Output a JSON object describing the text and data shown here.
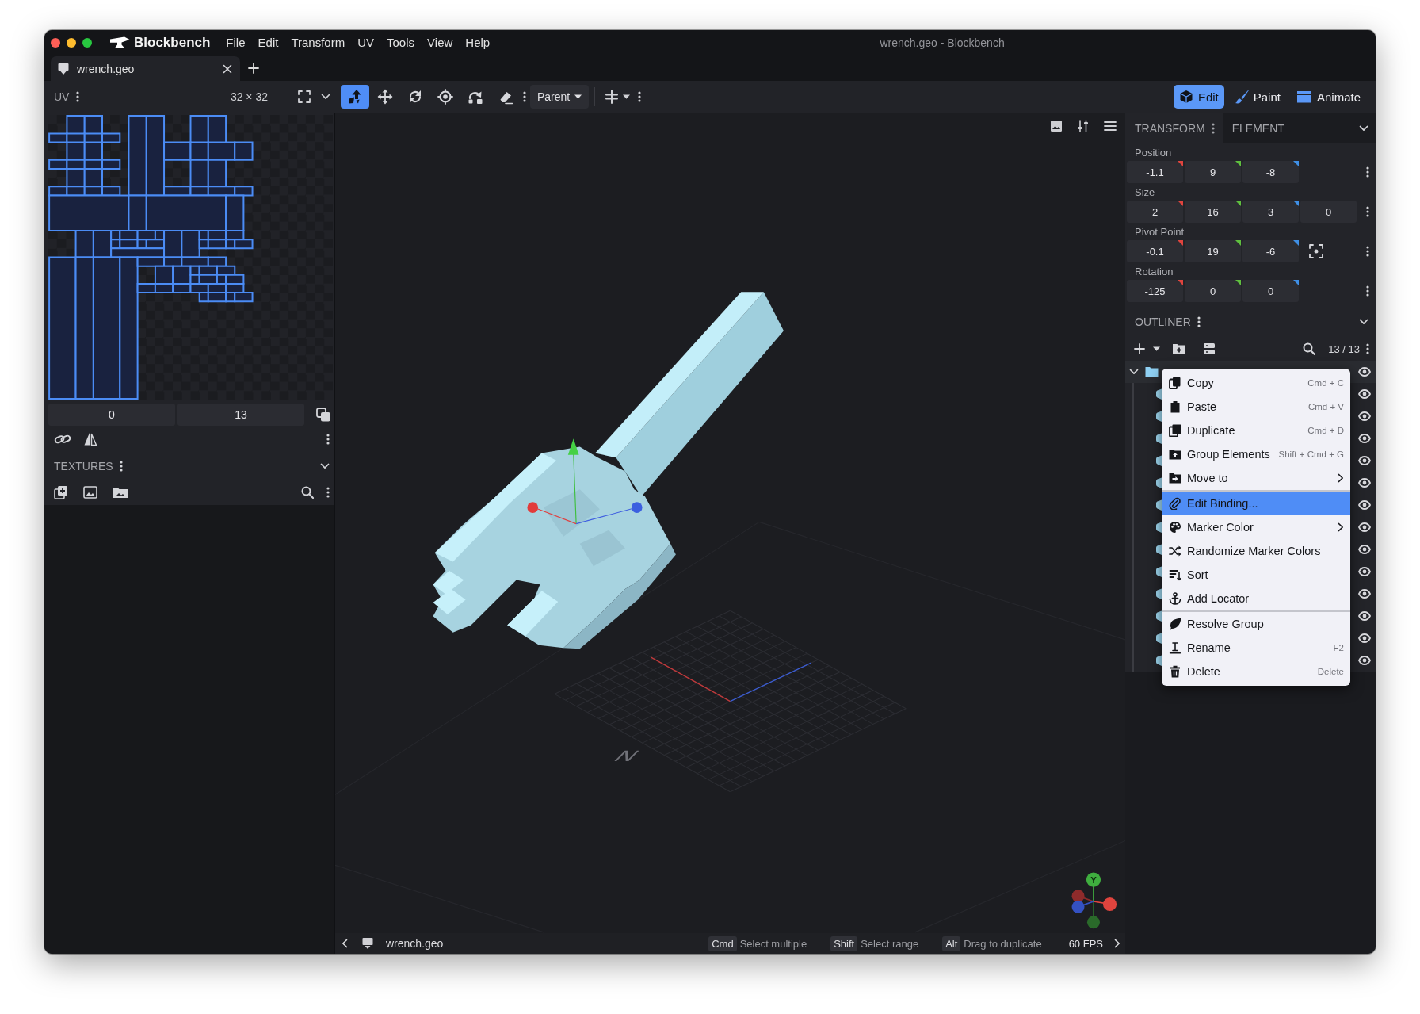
{
  "window": {
    "app_name": "Blockbench",
    "title": "wrench.geo - Blockbench"
  },
  "menu_bar": [
    "File",
    "Edit",
    "Transform",
    "UV",
    "Tools",
    "View",
    "Help"
  ],
  "tabs": [
    {
      "label": "wrench.geo",
      "selected": true
    }
  ],
  "toolbar": {
    "uv_title": "UV",
    "texture_size": "32 × 32",
    "tools": [
      {
        "selected": true
      },
      {
        "selected": false
      },
      {
        "selected": false
      },
      {
        "selected": false
      },
      {
        "selected": false
      },
      {
        "selected": false
      }
    ],
    "transform_space": "Parent"
  },
  "modes": [
    {
      "label": "Edit",
      "selected": true
    },
    {
      "label": "Paint",
      "selected": false
    },
    {
      "label": "Animate",
      "selected": false
    }
  ],
  "uv_panel": {
    "fields": [
      "0",
      "13"
    ]
  },
  "textures_panel": {
    "title": "TEXTURES"
  },
  "viewport": {
    "compass_label": "N",
    "axis_label": "Y"
  },
  "transform_panel": {
    "tabs": [
      {
        "label": "TRANSFORM",
        "selected": true
      },
      {
        "label": "ELEMENT",
        "selected": false
      }
    ],
    "rows": [
      {
        "kind": "vector",
        "label": "Position",
        "values": [
          "-1.1",
          "9",
          "-8"
        ]
      },
      {
        "kind": "vector",
        "label": "Size",
        "values": [
          "2",
          "16",
          "3",
          "0"
        ]
      },
      {
        "kind": "pivot",
        "label": "Pivot Point",
        "values": [
          "-0.1",
          "19",
          "-6"
        ]
      },
      {
        "kind": "vector",
        "label": "Rotation",
        "values": [
          "-125",
          "0",
          "0"
        ]
      }
    ]
  },
  "outliner": {
    "title": "OUTLINER",
    "count": "13 / 13",
    "tree": [
      {
        "kind": "group",
        "expanded": true,
        "visible": true,
        "children": [
          {
            "kind": "cube",
            "visible": true
          },
          {
            "kind": "cube",
            "visible": true
          },
          {
            "kind": "cube",
            "visible": true
          },
          {
            "kind": "cube",
            "visible": true
          },
          {
            "kind": "cube",
            "visible": true
          },
          {
            "kind": "cube",
            "visible": true
          },
          {
            "kind": "cube",
            "visible": true
          },
          {
            "kind": "cube",
            "visible": true
          },
          {
            "kind": "cube",
            "visible": true
          },
          {
            "kind": "cube",
            "visible": true
          },
          {
            "kind": "cube",
            "visible": true
          },
          {
            "kind": "cube",
            "visible": true
          },
          {
            "kind": "cube",
            "visible": true
          }
        ]
      }
    ]
  },
  "context_menu": {
    "items": [
      {
        "label": "Copy",
        "shortcut": "Cmd + C",
        "selected": false,
        "submenu": false,
        "separator_before": false
      },
      {
        "label": "Paste",
        "shortcut": "Cmd + V",
        "selected": false,
        "submenu": false,
        "separator_before": false
      },
      {
        "label": "Duplicate",
        "shortcut": "Cmd + D",
        "selected": false,
        "submenu": false,
        "separator_before": false
      },
      {
        "label": "Group Elements",
        "shortcut": "Shift + Cmd + G",
        "selected": false,
        "submenu": false,
        "separator_before": false
      },
      {
        "label": "Move to",
        "selected": false,
        "submenu": true,
        "separator_before": false
      },
      {
        "label": "Edit Binding...",
        "selected": true,
        "submenu": false,
        "separator_before": true
      },
      {
        "label": "Marker Color",
        "selected": false,
        "submenu": true,
        "separator_before": false
      },
      {
        "label": "Randomize Marker Colors",
        "selected": false,
        "submenu": false,
        "separator_before": false
      },
      {
        "label": "Sort",
        "selected": false,
        "submenu": false,
        "separator_before": false
      },
      {
        "label": "Add Locator",
        "selected": false,
        "submenu": false,
        "separator_before": false
      },
      {
        "label": "Resolve Group",
        "selected": false,
        "submenu": false,
        "separator_before": true
      },
      {
        "label": "Rename",
        "shortcut": "F2",
        "selected": false,
        "submenu": false,
        "separator_before": false
      },
      {
        "label": "Delete",
        "shortcut": "Delete",
        "selected": false,
        "submenu": false,
        "separator_before": false
      }
    ]
  },
  "status_bar": {
    "file_name": "wrench.geo",
    "hints": [
      {
        "key": "Cmd",
        "text": "Select multiple"
      },
      {
        "key": "Shift",
        "text": "Select range"
      },
      {
        "key": "Alt",
        "text": "Drag to duplicate"
      }
    ],
    "fps": "60 FPS"
  }
}
